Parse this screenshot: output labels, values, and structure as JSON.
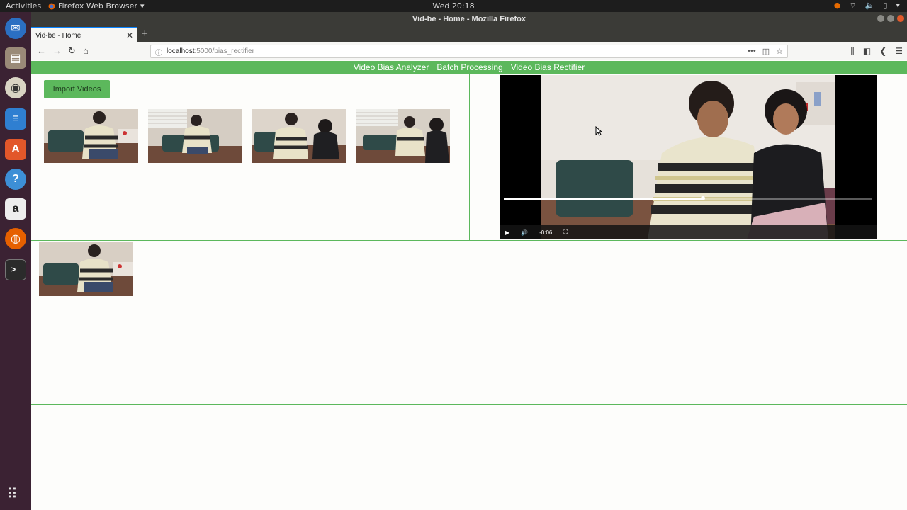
{
  "system": {
    "activities": "Activities",
    "app_menu": "Firefox Web Browser",
    "clock": "Wed 20:18"
  },
  "window": {
    "title": "Vid-be - Home - Mozilla Firefox"
  },
  "browser": {
    "tab_title": "Vid-be - Home",
    "url_host": "localhost",
    "url_path": ":5000/bias_rectifier"
  },
  "app": {
    "nav": [
      "Video Bias Analyzer",
      "Batch Processing",
      "Video Bias Rectifier"
    ],
    "import_button": "Import Videos",
    "player": {
      "time_remaining": "-0:06",
      "progress_fraction": 0.54
    }
  },
  "colors": {
    "accent": "#5cb85c",
    "dock": "#3b2233"
  }
}
